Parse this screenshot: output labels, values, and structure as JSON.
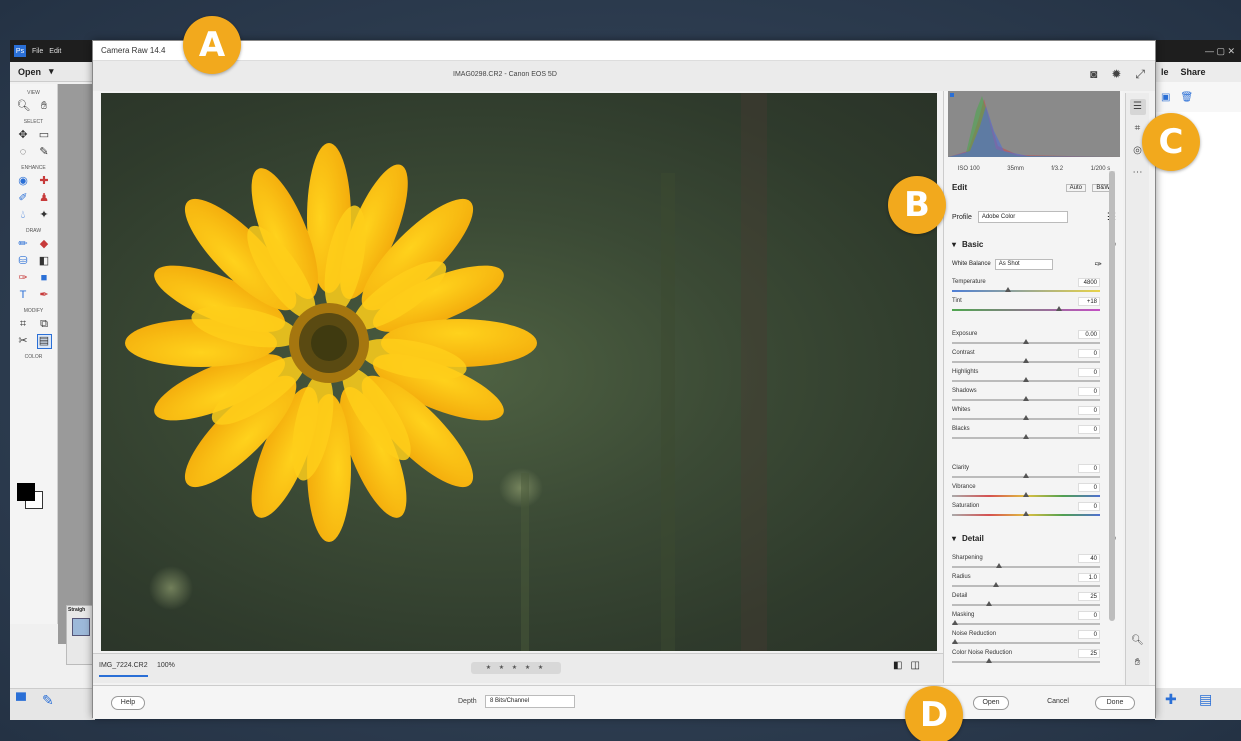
{
  "background_app": {
    "menu": [
      "File",
      "Edit"
    ],
    "open_label": "Open",
    "tool_sections": [
      "VIEW",
      "SELECT",
      "ENHANCE",
      "DRAW",
      "MODIFY",
      "COLOR"
    ],
    "right_title": "",
    "right_menu": [
      "le",
      "Share"
    ],
    "panel_title": "Straigh"
  },
  "dialog": {
    "title": "Camera Raw 14.4",
    "file_info": "IMAG0298.CR2  -  Canon EOS 5D",
    "preview_tabs": [
      "IMG_7224.CR2",
      "100%"
    ],
    "stars": "★ ★ ★ ★ ★",
    "depth_label": "Depth",
    "depth_value": "8 Bits/Channel",
    "buttons": {
      "help": "Help",
      "open": "Open",
      "cancel": "Cancel",
      "done": "Done"
    }
  },
  "panel": {
    "hist_meta": [
      "ISO 100",
      "35mm",
      "f/3.2",
      "1/200 s"
    ],
    "edit_label": "Edit",
    "auto_label": "Auto",
    "bw_label": "B&W",
    "profile_label": "Profile",
    "profile_value": "Adobe Color",
    "basic_label": "Basic",
    "detail_label": "Detail",
    "white_balance_label": "White Balance",
    "white_balance_value": "As Shot",
    "basic_sliders": [
      {
        "label": "Temperature",
        "value": "4800",
        "pos": 0.38
      },
      {
        "label": "Tint",
        "value": "+18",
        "pos": 0.72
      },
      {
        "label": "Exposure",
        "value": "0.00",
        "pos": 0.5
      },
      {
        "label": "Contrast",
        "value": "0",
        "pos": 0.5
      },
      {
        "label": "Highlights",
        "value": "0",
        "pos": 0.5
      },
      {
        "label": "Shadows",
        "value": "0",
        "pos": 0.5
      },
      {
        "label": "Whites",
        "value": "0",
        "pos": 0.5
      },
      {
        "label": "Blacks",
        "value": "0",
        "pos": 0.5
      },
      {
        "label": "Clarity",
        "value": "0",
        "pos": 0.5
      },
      {
        "label": "Vibrance",
        "value": "0",
        "pos": 0.5
      },
      {
        "label": "Saturation",
        "value": "0",
        "pos": 0.5
      }
    ],
    "detail_sliders": [
      {
        "label": "Sharpening",
        "value": "40",
        "pos": 0.32
      },
      {
        "label": "Radius",
        "value": "1.0",
        "pos": 0.3
      },
      {
        "label": "Detail",
        "value": "25",
        "pos": 0.25
      },
      {
        "label": "Masking",
        "value": "0",
        "pos": 0.02
      },
      {
        "label": "Noise Reduction",
        "value": "0",
        "pos": 0.02
      },
      {
        "label": "Color Noise Reduction",
        "value": "25",
        "pos": 0.25
      }
    ]
  },
  "callouts": [
    "A",
    "B",
    "C",
    "D"
  ]
}
